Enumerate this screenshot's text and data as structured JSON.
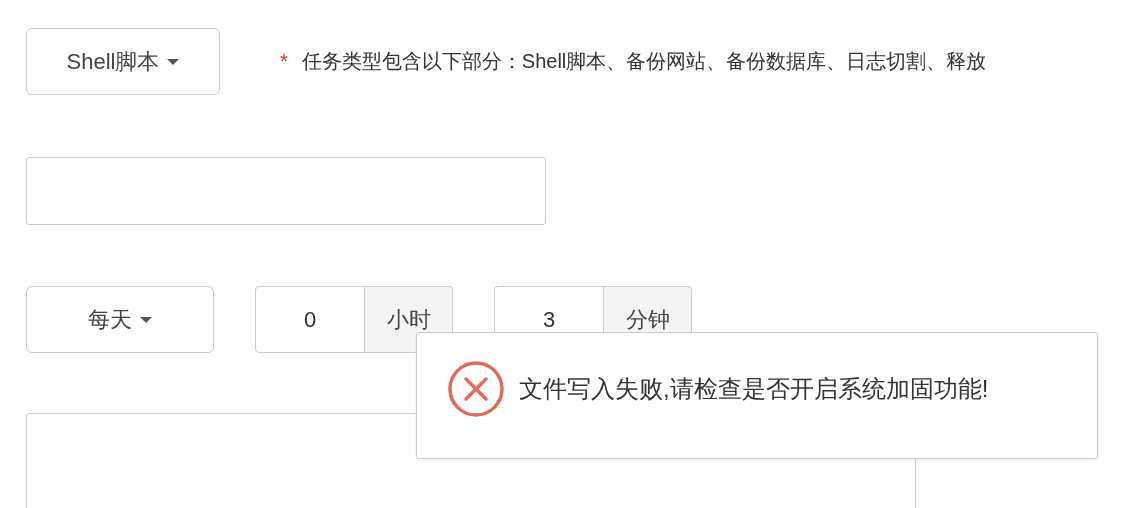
{
  "task_type": {
    "value": "Shell脚本"
  },
  "hint": {
    "mark": "*",
    "text": "任务类型包含以下部分：Shell脚本、备份网站、备份数据库、日志切割、释放"
  },
  "schedule": {
    "period": "每天",
    "hour": {
      "value": "0",
      "unit": "小时"
    },
    "minute": {
      "value": "3",
      "unit": "分钟"
    }
  },
  "toast": {
    "kind": "error",
    "message": "文件写入失败,请检查是否开启系统加固功能!"
  }
}
